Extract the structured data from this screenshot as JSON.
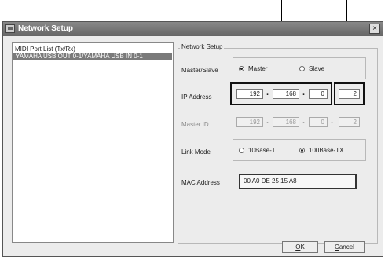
{
  "window": {
    "title": "Network Setup",
    "close_glyph": "×"
  },
  "port_list": {
    "header": "MIDI Port List (Tx/Rx)",
    "items": [
      "YAMAHA USB OUT 0-1/YAMAHA USB IN 0-1"
    ]
  },
  "network_setup": {
    "group_label": "Network Setup",
    "master_slave": {
      "label": "Master/Slave",
      "options": [
        "Master",
        "Slave"
      ],
      "selected": "Master"
    },
    "ip_address": {
      "label": "IP Address",
      "octets": [
        "192",
        "168",
        "0",
        "2"
      ]
    },
    "master_id": {
      "label": "Master ID",
      "octets": [
        "192",
        "168",
        "0",
        "2"
      ],
      "enabled": false
    },
    "link_mode": {
      "label": "Link Mode",
      "options": [
        "10Base-T",
        "100Base-TX"
      ],
      "selected": "100Base-TX"
    },
    "mac_address": {
      "label": "MAC Address",
      "value": "00 A0 DE 25 15 A8"
    }
  },
  "buttons": {
    "ok": {
      "mnemonic": "O",
      "rest": "K"
    },
    "cancel": {
      "mnemonic": "C",
      "rest": "ancel"
    }
  },
  "octet_separator": "."
}
